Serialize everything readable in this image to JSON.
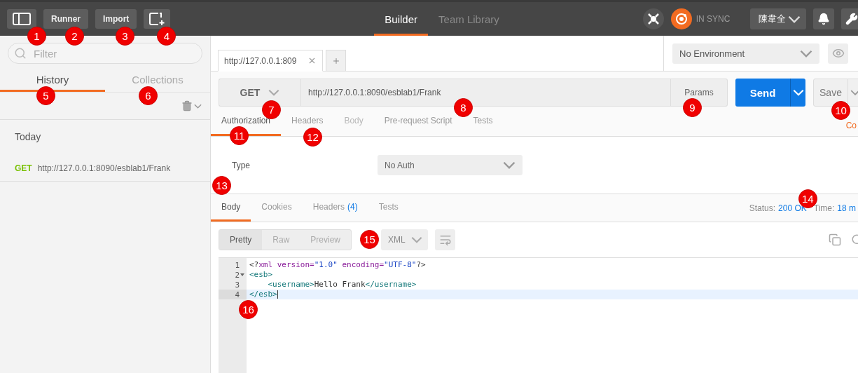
{
  "toolbar": {
    "sidebar_toggle": {
      "marker": "1"
    },
    "buttons": [
      {
        "label": "Runner",
        "marker": "2"
      },
      {
        "label": "Import",
        "marker": "3"
      }
    ],
    "new_tab": {
      "marker": "4"
    },
    "tabs": [
      {
        "label": "Builder",
        "selected": true
      },
      {
        "label": "Team Library",
        "selected": false
      }
    ],
    "sync_status": "IN SYNC",
    "user": "陳韋全"
  },
  "sidebar": {
    "filter": {
      "placeholder": "Filter"
    },
    "tabs": [
      {
        "label": "History",
        "selected": true,
        "marker": "5"
      },
      {
        "label": "Collections",
        "selected": false,
        "marker": "6"
      }
    ],
    "history": [
      {
        "group": "Today",
        "items": [
          {
            "method": "GET",
            "url": "http://127.0.0.1:8090/esblab1/Frank"
          }
        ]
      }
    ]
  },
  "request_tabs": [
    {
      "label": "http://127.0.0.1:809",
      "selected": true
    }
  ],
  "environment": "No Environment",
  "request": {
    "method": "GET",
    "method_marker": "7",
    "url": "http://127.0.0.1:8090/esblab1/Frank",
    "url_marker": "8",
    "params": {
      "label": "Params",
      "marker": "9"
    },
    "send": "Send",
    "save": {
      "label": "Save",
      "marker": "10"
    }
  },
  "request_sections": [
    {
      "label": "Authorization",
      "selected": true,
      "disabled": false,
      "marker": "11"
    },
    {
      "label": "Headers",
      "selected": false,
      "disabled": false,
      "marker": "12"
    },
    {
      "label": "Body",
      "selected": false,
      "disabled": true
    },
    {
      "label": "Pre-request Script",
      "selected": false,
      "disabled": false
    },
    {
      "label": "Tests",
      "selected": false,
      "disabled": false
    }
  ],
  "code_link": "Co",
  "auth": {
    "label": "Type",
    "value": "No Auth"
  },
  "response": {
    "tabs": [
      {
        "label": "Body",
        "selected": true,
        "marker": "13"
      },
      {
        "label": "Cookies",
        "selected": false
      },
      {
        "label": "Headers",
        "selected": false,
        "count": "(4)"
      },
      {
        "label": "Tests",
        "selected": false
      }
    ],
    "status_label": "Status:",
    "status": "200 OK",
    "time_label": "Time:",
    "time": "18 m",
    "time_marker": "14",
    "views": [
      {
        "label": "Pretty",
        "selected": true
      },
      {
        "label": "Raw",
        "selected": false
      },
      {
        "label": "Preview",
        "selected": false
      }
    ],
    "format": {
      "label": "XML",
      "marker": "15"
    },
    "code": [
      {
        "number": "1",
        "foldable": false,
        "active": false,
        "tokens": [
          {
            "kind": "punct",
            "text": "<?"
          },
          {
            "kind": "keyword",
            "text": "xml version="
          },
          {
            "kind": "string",
            "text": "\"1.0\""
          },
          {
            "kind": "keyword",
            "text": " encoding="
          },
          {
            "kind": "string",
            "text": "\"UTF-8\""
          },
          {
            "kind": "punct",
            "text": "?>"
          }
        ]
      },
      {
        "number": "2",
        "foldable": true,
        "active": false,
        "tokens": [
          {
            "kind": "tag",
            "text": "<esb>"
          }
        ]
      },
      {
        "number": "3",
        "foldable": false,
        "active": false,
        "tokens": [
          {
            "kind": "tag",
            "text": "    <username>"
          },
          {
            "kind": "text",
            "text": "Hello Frank"
          },
          {
            "kind": "tag",
            "text": "</username>"
          }
        ]
      },
      {
        "number": "4",
        "foldable": false,
        "active": true,
        "marker": "16",
        "tokens": [
          {
            "kind": "tag",
            "text": "</esb>"
          }
        ]
      }
    ]
  }
}
